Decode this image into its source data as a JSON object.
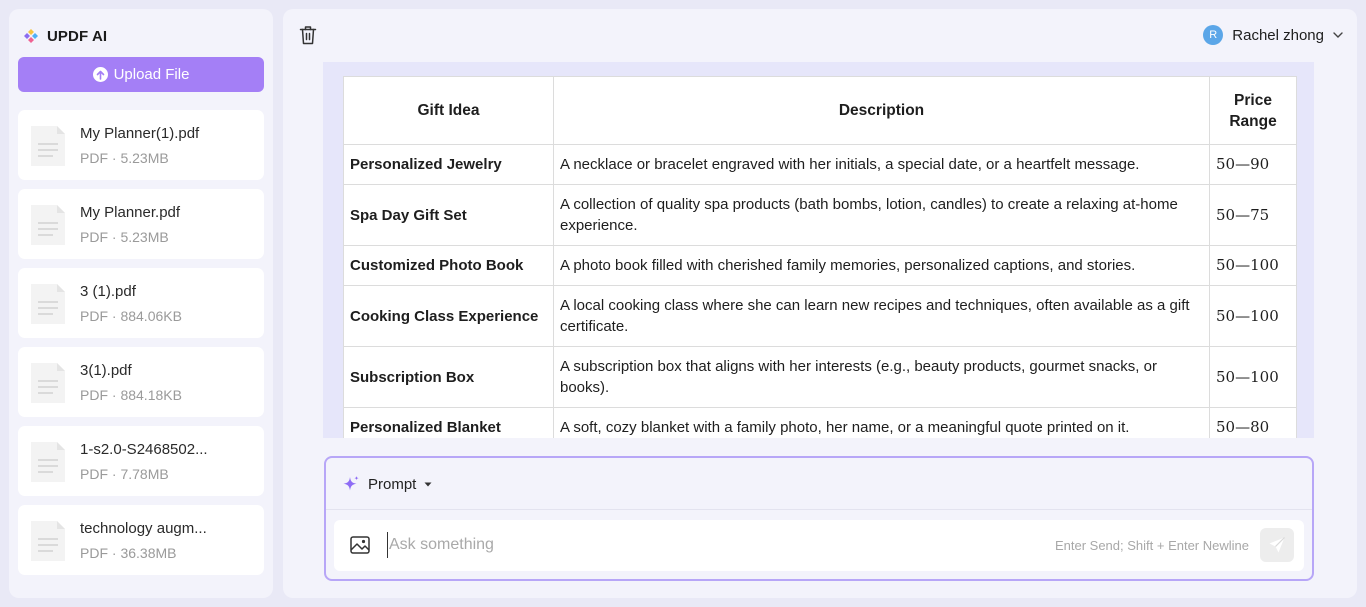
{
  "app": {
    "title": "UPDF AI",
    "brand_icon": "updf-logo-icon"
  },
  "sidebar": {
    "upload_label": "Upload File",
    "files": [
      {
        "name": "My Planner(1).pdf",
        "meta": "PDF · 5.23MB"
      },
      {
        "name": "My Planner.pdf",
        "meta": "PDF · 5.23MB"
      },
      {
        "name": "3 (1).pdf",
        "meta": "PDF · 884.06KB"
      },
      {
        "name": "3(1).pdf",
        "meta": "PDF · 884.18KB"
      },
      {
        "name": "1-s2.0-S2468502...",
        "meta": "PDF · 7.78MB"
      },
      {
        "name": "technology augm...",
        "meta": "PDF · 36.38MB"
      }
    ]
  },
  "header": {
    "user_initial": "R",
    "user_name": "Rachel zhong"
  },
  "table": {
    "headers": [
      "Gift Idea",
      "Description",
      "Price Range"
    ],
    "rows": [
      {
        "gift": "Personalized Jewelry",
        "description": "A necklace or bracelet engraved with her initials, a special date, or a heartfelt message.",
        "price": "50—90"
      },
      {
        "gift": "Spa Day Gift Set",
        "description": "A collection of quality spa products (bath bombs, lotion, candles) to create a relaxing at-home experience.",
        "price": "50—75"
      },
      {
        "gift": "Customized Photo Book",
        "description": "A photo book filled with cherished family memories, personalized captions, and stories.",
        "price": "50—100"
      },
      {
        "gift": "Cooking Class Experience",
        "description": "A local cooking class where she can learn new recipes and techniques, often available as a gift certificate.",
        "price": "50—100"
      },
      {
        "gift": "Subscription Box",
        "description": "A subscription box that aligns with her interests (e.g., beauty products, gourmet snacks, or books).",
        "price": "50—100"
      },
      {
        "gift": "Personalized Blanket",
        "description": "A soft, cozy blanket with a family photo, her name, or a meaningful quote printed on it.",
        "price": "50—80"
      }
    ]
  },
  "composer": {
    "prompt_label": "Prompt",
    "input_placeholder": "Ask something",
    "input_value": "",
    "hint": "Enter Send; Shift + Enter Newline"
  },
  "colors": {
    "accent": "#a47ff6",
    "composer_border": "#b7a6f7",
    "avatar": "#5ba6e8"
  }
}
